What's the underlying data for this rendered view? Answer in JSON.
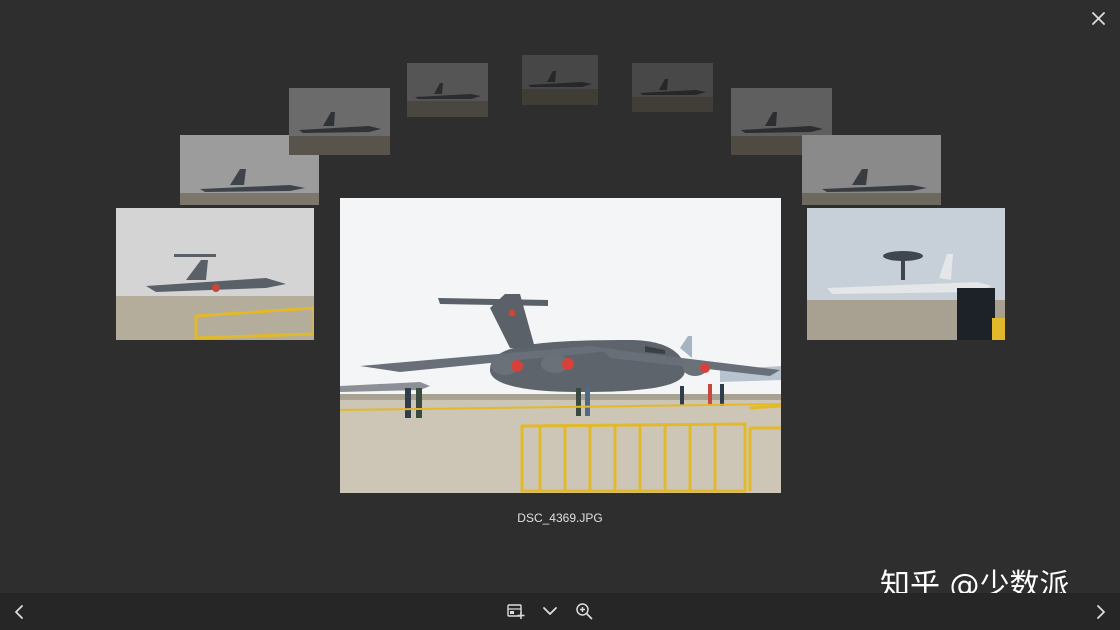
{
  "viewer": {
    "filename": "DSC_4369.JPG",
    "watermark": "知乎 @少数派"
  },
  "icons": {
    "close": "close-icon",
    "prev": "chevron-left-icon",
    "next": "chevron-right-icon",
    "gallery": "gallery-add-icon",
    "expand": "chevron-down-icon",
    "zoom": "zoom-in-icon"
  },
  "colors": {
    "background": "#2e2e2e",
    "bottombar": "#262626",
    "icon": "#dddddd",
    "fence": "#e3b92c"
  }
}
